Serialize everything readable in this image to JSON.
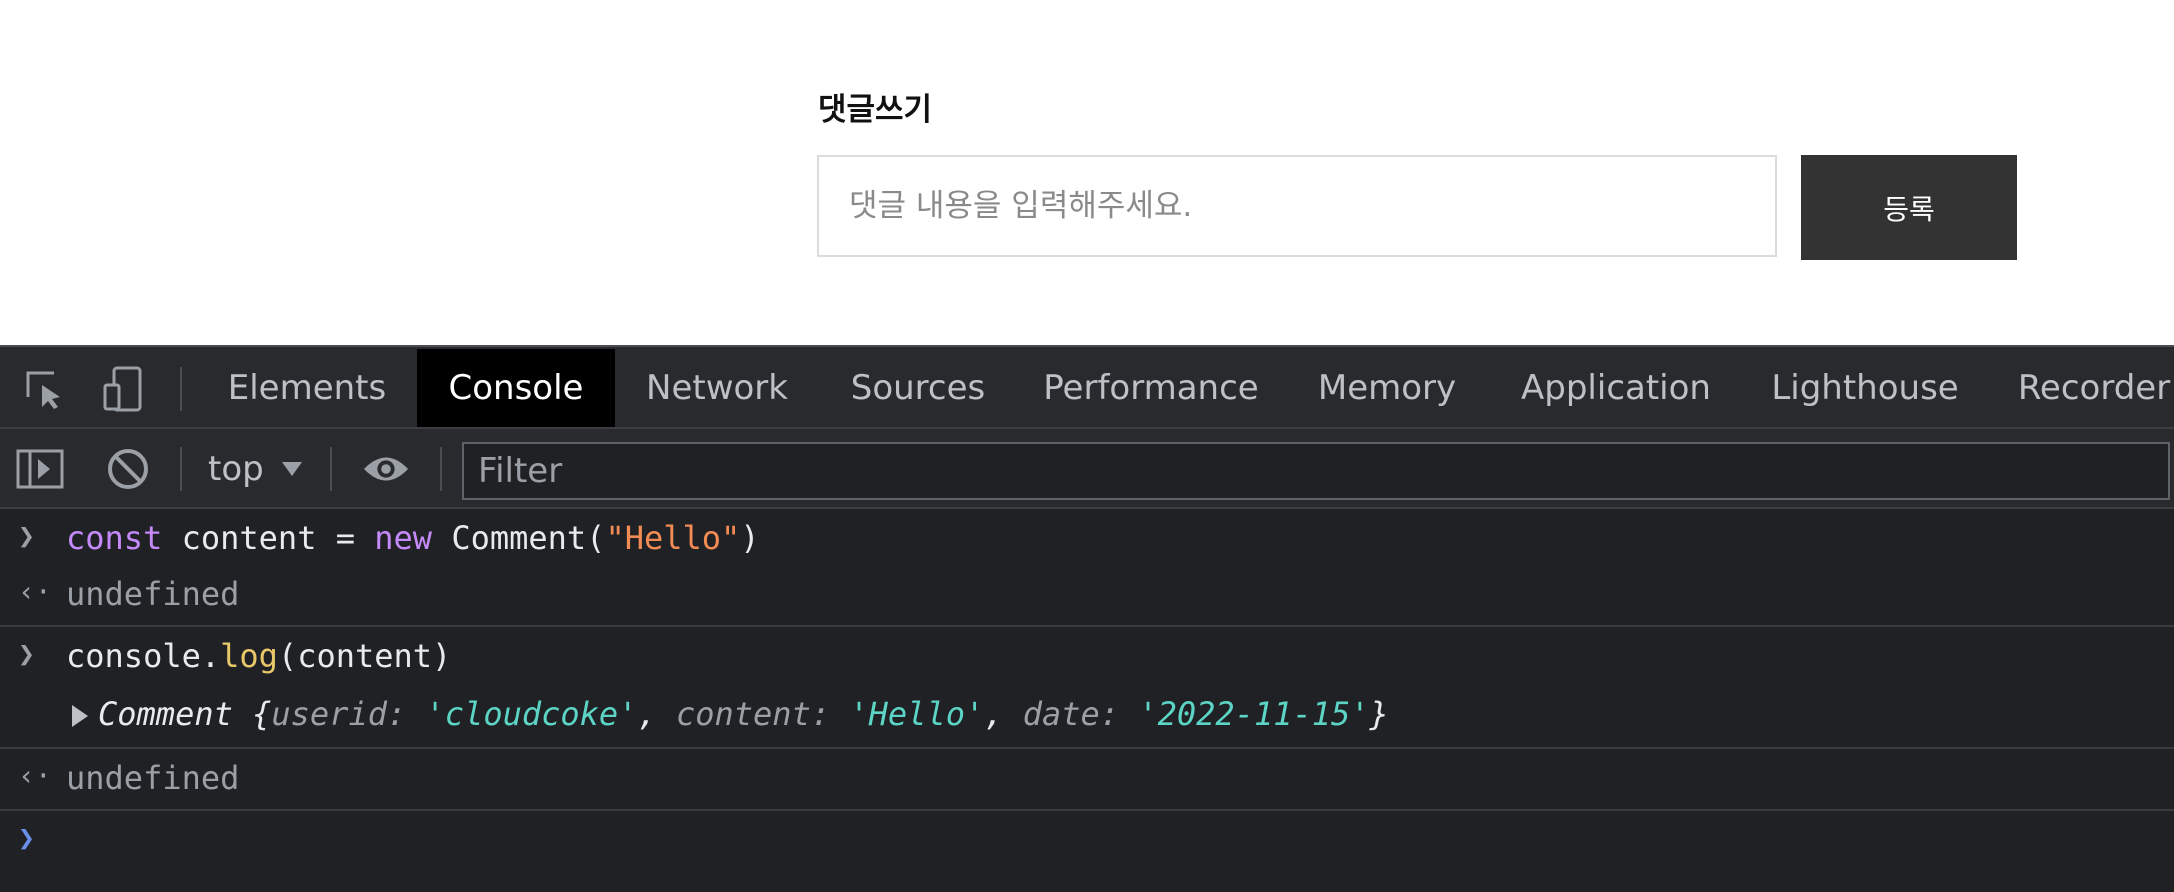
{
  "page": {
    "comment_title": "댓글쓰기",
    "comment_placeholder": "댓글 내용을 입력해주세요.",
    "submit_label": "등록"
  },
  "devtools": {
    "tabs": [
      "Elements",
      "Console",
      "Network",
      "Sources",
      "Performance",
      "Memory",
      "Application",
      "Lighthouse",
      "Recorder"
    ],
    "active_tab": "Console",
    "context": "top",
    "filter_placeholder": "Filter",
    "console": {
      "line1": {
        "kw": "const",
        "ident": " content = ",
        "kw2": "new",
        "call": " Comment(",
        "str": "\"Hello\"",
        "close": ")"
      },
      "result1": "undefined",
      "line2": {
        "obj": "console.",
        "fn": "log",
        "args": "(content)"
      },
      "object": {
        "class_name": "Comment",
        "open": " {",
        "k1": "userid",
        "v1": "'cloudcoke'",
        "k2": "content",
        "v2": "'Hello'",
        "k3": "date",
        "v3": "'2022-11-15'",
        "close": "}"
      },
      "result2": "undefined"
    },
    "icons": [
      "inspect-element-icon",
      "device-toggle-icon",
      "sidebar-toggle-icon",
      "clear-console-icon",
      "live-expression-eye-icon"
    ]
  },
  "colors": {
    "tabbar_bg": "#292a2d",
    "console_bg": "#202124",
    "keyword": "#c58af9",
    "string": "#f28b54",
    "function": "#e8c76b",
    "object_value": "#5cd5c6",
    "submit_bg": "#333333"
  }
}
